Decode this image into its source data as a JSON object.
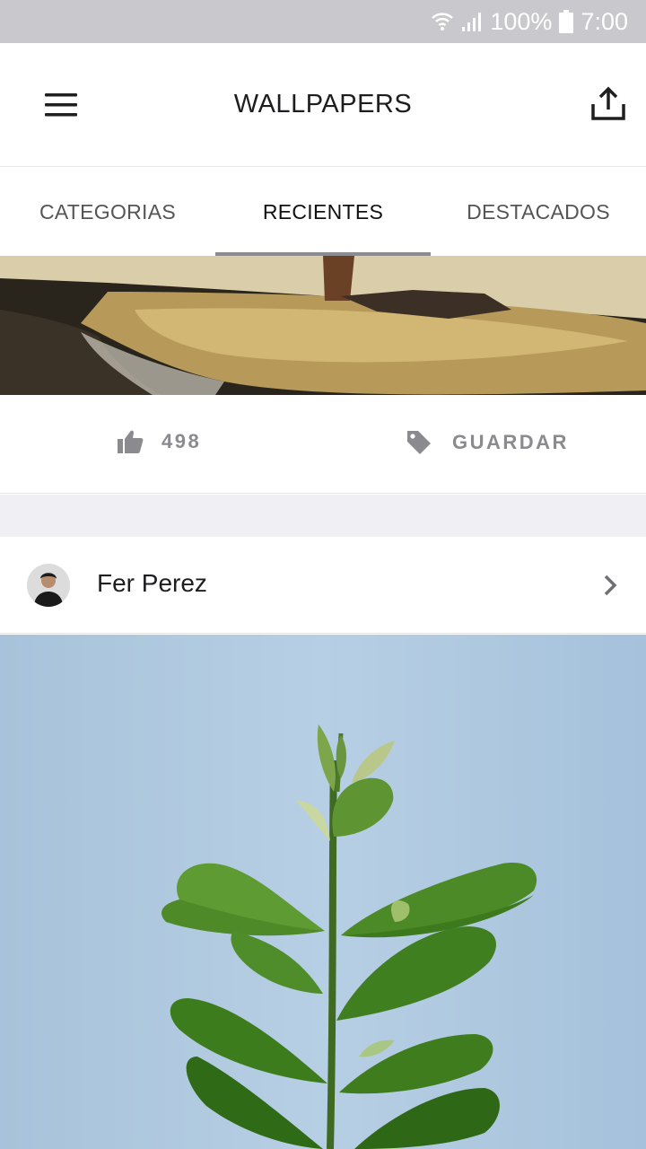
{
  "status_bar": {
    "battery_percent": "100%",
    "time": "7:00",
    "icons": [
      "wifi-icon",
      "signal-icon",
      "battery-icon"
    ]
  },
  "app_bar": {
    "title": "WALLPAPERS",
    "icons": [
      "menu-icon",
      "share-icon"
    ]
  },
  "tabs": [
    {
      "label": "CATEGORIAS",
      "active": false
    },
    {
      "label": "RECIENTES",
      "active": true
    },
    {
      "label": "DESTACADOS",
      "active": false
    }
  ],
  "post1": {
    "likes": "498",
    "save_label": "GUARDAR",
    "icons": [
      "thumbs-up-icon",
      "tag-icon"
    ]
  },
  "post2": {
    "author": "Fer Perez",
    "icons": [
      "chevron-right-icon"
    ]
  },
  "colors": {
    "status_bar": "#c9c8cc",
    "tab_indicator": "#8c8c8f",
    "action_text": "#8b8b8f",
    "sky": "#aac5de"
  }
}
